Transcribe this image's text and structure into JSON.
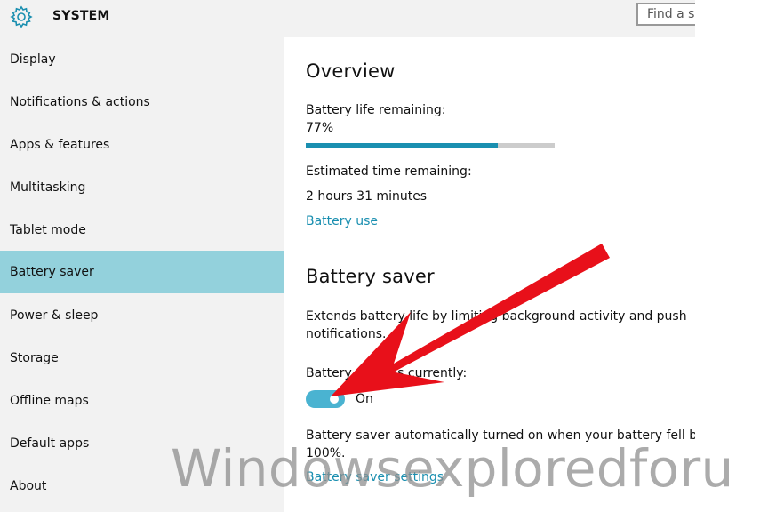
{
  "header": {
    "title": "SYSTEM",
    "search_placeholder": "Find a se"
  },
  "sidebar": {
    "items": [
      {
        "label": "Display"
      },
      {
        "label": "Notifications & actions"
      },
      {
        "label": "Apps & features"
      },
      {
        "label": "Multitasking"
      },
      {
        "label": "Tablet mode"
      },
      {
        "label": "Battery saver",
        "active": true
      },
      {
        "label": "Power & sleep"
      },
      {
        "label": "Storage"
      },
      {
        "label": "Offline maps"
      },
      {
        "label": "Default apps"
      },
      {
        "label": "About"
      }
    ]
  },
  "overview": {
    "heading": "Overview",
    "battery_life_label": "Battery life remaining:",
    "battery_percent": "77%",
    "battery_fraction": 0.77,
    "estimated_label": "Estimated time remaining:",
    "estimated_value": "2 hours 31 minutes",
    "battery_use_link": "Battery use"
  },
  "battery_saver": {
    "heading": "Battery saver",
    "description_line1": "Extends battery life by limiting background activity and push",
    "description_line2": "notifications.",
    "status_label": "Battery saver is currently:",
    "toggle_state": "On",
    "auto_line1": "Battery saver automatically turned on when your battery fell below",
    "auto_line2": "100%.",
    "settings_link": "Battery saver settings"
  },
  "watermark": "Windowsexploredforu",
  "colors": {
    "accent": "#1a8fb0",
    "selected_nav": "#93d1dc",
    "toggle_on": "#4ab3d1",
    "annotation_arrow": "#e8101a"
  }
}
